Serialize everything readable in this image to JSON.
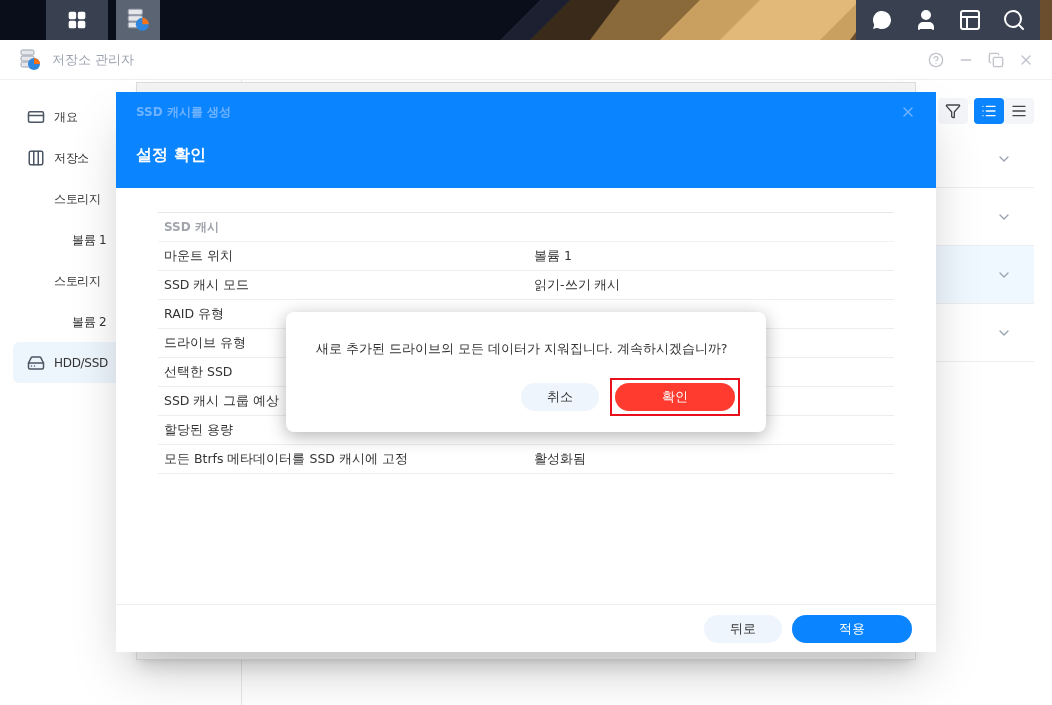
{
  "taskbar": {
    "buttons": [
      {
        "kind": "apps",
        "selected": false
      },
      {
        "kind": "storage",
        "selected": true
      }
    ],
    "tray": [
      {
        "kind": "chat"
      },
      {
        "kind": "user"
      },
      {
        "kind": "widgets"
      },
      {
        "kind": "search"
      }
    ]
  },
  "window": {
    "title": "저장소 관리자"
  },
  "sidebar": {
    "items": [
      {
        "label": "개요",
        "kind": "overview",
        "selected": false
      },
      {
        "label": "저장소",
        "kind": "storage",
        "selected": false,
        "children": [
          {
            "label": "스토리지",
            "selected": false,
            "children": [
              {
                "label": "볼륨 1",
                "selected": false
              }
            ]
          },
          {
            "label": "스토리지",
            "selected": false,
            "children": [
              {
                "label": "볼륨 2",
                "selected": false
              }
            ]
          }
        ]
      },
      {
        "label": "HDD/SSD",
        "kind": "drive",
        "selected": true
      }
    ]
  },
  "main": {
    "view_toggle": [
      {
        "kind": "list",
        "selected": true
      },
      {
        "kind": "compact",
        "selected": false
      }
    ],
    "rows": [
      {
        "selected": false
      },
      {
        "selected": false
      },
      {
        "selected": true
      },
      {
        "selected": false
      }
    ]
  },
  "wizard": {
    "subtitle": "SSD 캐시를 생성",
    "title": "설정 확인",
    "section": "SSD 캐시",
    "rows": [
      {
        "label": "마운트 위치",
        "value": "볼륨 1"
      },
      {
        "label": "SSD 캐시 모드",
        "value": "읽기-쓰기 캐시"
      },
      {
        "label": "RAID 유형"
      },
      {
        "label": "드라이브 유형"
      },
      {
        "label": "선택한 SSD"
      },
      {
        "label": "SSD 캐시 그룹 예상"
      },
      {
        "label": "할당된 용량"
      },
      {
        "label": "모든 Btrfs 메타데이터를 SSD 캐시에 고정",
        "value": "활성화됨"
      }
    ],
    "buttons": [
      {
        "label": "뒤로",
        "kind": "secondary"
      },
      {
        "label": "적용",
        "kind": "primary"
      }
    ]
  },
  "confirm": {
    "message": "새로 추가된 드라이브의 모든 데이터가 지워집니다. 계속하시겠습니까?",
    "buttons": [
      {
        "label": "취소",
        "kind": "secondary",
        "highlighted": false
      },
      {
        "label": "확인",
        "kind": "danger",
        "highlighted": true
      }
    ]
  }
}
